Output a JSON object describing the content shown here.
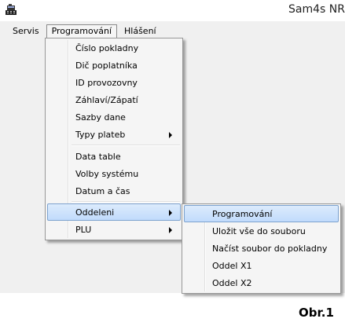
{
  "window": {
    "title": "Sam4s NR"
  },
  "menubar": {
    "items": [
      "Servis",
      "Programování",
      "Hlášení"
    ]
  },
  "programovani_menu": {
    "items": [
      {
        "label": "Číslo pokladny",
        "submenu": false
      },
      {
        "label": "Dič poplatníka",
        "submenu": false
      },
      {
        "label": "ID provozovny",
        "submenu": false
      },
      {
        "label": "Záhlaví/Zápatí",
        "submenu": false
      },
      {
        "label": "Sazby dane",
        "submenu": false
      },
      {
        "label": "Typy plateb",
        "submenu": true
      },
      {
        "label": "Data table",
        "submenu": false
      },
      {
        "label": "Volby systému",
        "submenu": false
      },
      {
        "label": "Datum a čas",
        "submenu": false
      },
      {
        "label": "Oddeleni",
        "submenu": true,
        "highlighted": true
      },
      {
        "label": "PLU",
        "submenu": true
      }
    ]
  },
  "oddeleni_submenu": {
    "items": [
      {
        "label": "Programování",
        "highlighted": true
      },
      {
        "label": "Uložit vše do souboru"
      },
      {
        "label": "Načíst soubor do pokladny"
      },
      {
        "label": "Oddel X1"
      },
      {
        "label": "Oddel X2"
      }
    ]
  },
  "caption": "Obr.1",
  "colors": {
    "menu_bg": "#f5f5f5",
    "highlight": "#c1dbfc",
    "highlight_border": "#7da2ce",
    "client_bg": "#f0f0f0"
  }
}
